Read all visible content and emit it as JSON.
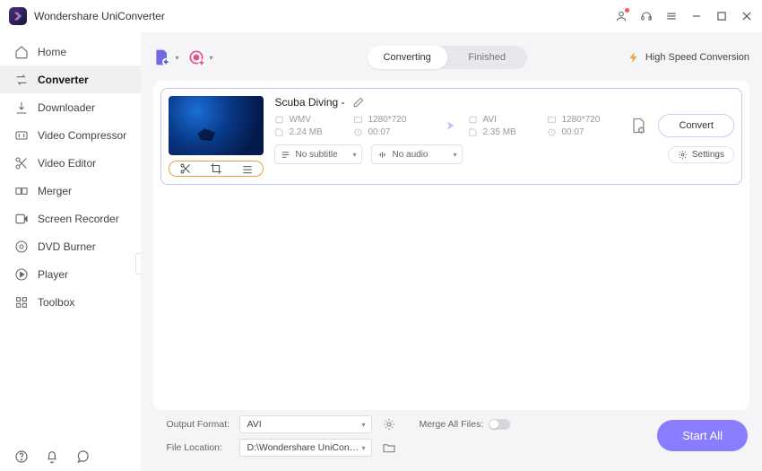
{
  "app": {
    "title": "Wondershare UniConverter"
  },
  "sidebar": {
    "items": [
      {
        "label": "Home"
      },
      {
        "label": "Converter"
      },
      {
        "label": "Downloader"
      },
      {
        "label": "Video Compressor"
      },
      {
        "label": "Video Editor"
      },
      {
        "label": "Merger"
      },
      {
        "label": "Screen Recorder"
      },
      {
        "label": "DVD Burner"
      },
      {
        "label": "Player"
      },
      {
        "label": "Toolbox"
      }
    ]
  },
  "tabs": {
    "converting": "Converting",
    "finished": "Finished"
  },
  "header": {
    "high_speed": "High Speed Conversion"
  },
  "item": {
    "title": "Scuba Diving -",
    "src": {
      "format": "WMV",
      "resolution": "1280*720",
      "size": "2.24 MB",
      "duration": "00:07"
    },
    "dst": {
      "format": "AVI",
      "resolution": "1280*720",
      "size": "2.35 MB",
      "duration": "00:07"
    },
    "subtitle": "No subtitle",
    "audio": "No audio",
    "settings": "Settings",
    "convert": "Convert"
  },
  "footer": {
    "output_format_label": "Output Format:",
    "output_format_value": "AVI",
    "file_location_label": "File Location:",
    "file_location_value": "D:\\Wondershare UniConverter",
    "merge_label": "Merge All Files:",
    "start_all": "Start All"
  }
}
